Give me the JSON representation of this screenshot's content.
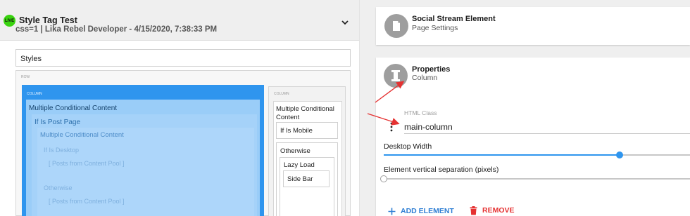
{
  "left": {
    "live_badge": "LIVE",
    "title": "Style Tag Test",
    "subtitle": "css=1 | Lika Rebel Developer - 4/15/2020, 7:38:33 PM",
    "styles_label": "Styles",
    "row_label": "ROW",
    "column_label": "COLUMN",
    "blue_column": {
      "mcc": "Multiple Conditional Content",
      "if_post": "If Is Post Page",
      "mcc_inner": "Multiple Conditional Content",
      "if_desktop": "If Is Desktop",
      "list1": "[ Posts from Content Pool ]",
      "otherwise": "Otherwise",
      "list2": "[ Posts from Content Pool ]"
    },
    "right_column": {
      "mcc": "Multiple Conditional Content",
      "if_mobile": "If Is Mobile",
      "otherwise": "Otherwise",
      "lazy_load": "Lazy Load",
      "side_bar": "Side Bar"
    }
  },
  "right": {
    "card1": {
      "title": "Social Stream Element",
      "subtitle": "Page Settings",
      "icon": "document-icon"
    },
    "card2": {
      "title": "Properties",
      "subtitle": "Column",
      "icon": "column-icon"
    },
    "html_class": {
      "label": "HTML Class",
      "value": "main-column"
    },
    "desktop_width": {
      "label": "Desktop Width",
      "value_fraction": 0.77
    },
    "vertical_sep": {
      "label": "Element vertical separation (pixels)",
      "value_fraction": 0.0
    },
    "add_element": "ADD ELEMENT",
    "remove": "REMOVE"
  },
  "colors": {
    "accent": "#2f95ee",
    "live": "#39d30e",
    "danger": "#e53131",
    "arrow": "#e53131"
  }
}
